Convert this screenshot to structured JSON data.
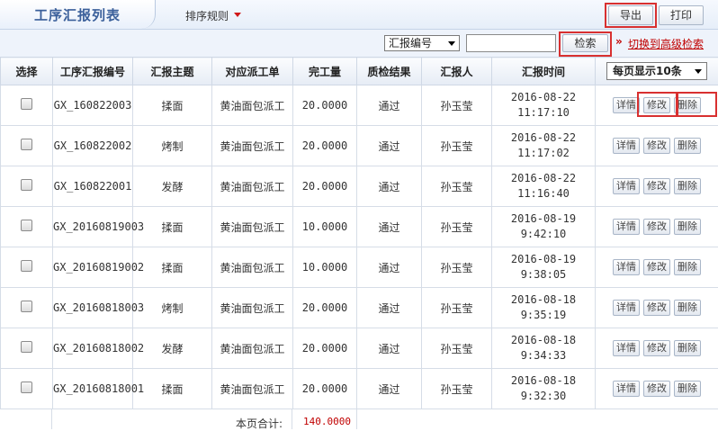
{
  "header": {
    "title": "工序汇报列表",
    "sort_label": "排序规则",
    "export_label": "导出",
    "print_label": "打印"
  },
  "search": {
    "field_selected": "汇报编号",
    "value": "",
    "search_label": "检索",
    "advanced_label": "切换到高级检索",
    "advanced_prefix": "»"
  },
  "table": {
    "columns": [
      "选择",
      "工序汇报编号",
      "汇报主题",
      "对应派工单",
      "完工量",
      "质检结果",
      "汇报人",
      "汇报时间"
    ],
    "per_page": "每页显示10条",
    "actions": {
      "detail": "详情",
      "edit": "修改",
      "delete": "删除"
    },
    "rows": [
      {
        "code": "GX_160822003",
        "subject": "揉面",
        "order": "黄油面包派工",
        "qty": "20.0000",
        "qc": "通过",
        "reporter": "孙玉莹",
        "time": "2016-08-22 11:17:10"
      },
      {
        "code": "GX_160822002",
        "subject": "烤制",
        "order": "黄油面包派工",
        "qty": "20.0000",
        "qc": "通过",
        "reporter": "孙玉莹",
        "time": "2016-08-22 11:17:02"
      },
      {
        "code": "GX_160822001",
        "subject": "发酵",
        "order": "黄油面包派工",
        "qty": "20.0000",
        "qc": "通过",
        "reporter": "孙玉莹",
        "time": "2016-08-22 11:16:40"
      },
      {
        "code": "GX_20160819003",
        "subject": "揉面",
        "order": "黄油面包派工",
        "qty": "10.0000",
        "qc": "通过",
        "reporter": "孙玉莹",
        "time": "2016-08-19 9:42:10"
      },
      {
        "code": "GX_20160819002",
        "subject": "揉面",
        "order": "黄油面包派工",
        "qty": "10.0000",
        "qc": "通过",
        "reporter": "孙玉莹",
        "time": "2016-08-19 9:38:05"
      },
      {
        "code": "GX_20160818003",
        "subject": "烤制",
        "order": "黄油面包派工",
        "qty": "20.0000",
        "qc": "通过",
        "reporter": "孙玉莹",
        "time": "2016-08-18 9:35:19"
      },
      {
        "code": "GX_20160818002",
        "subject": "发酵",
        "order": "黄油面包派工",
        "qty": "20.0000",
        "qc": "通过",
        "reporter": "孙玉莹",
        "time": "2016-08-18 9:34:33"
      },
      {
        "code": "GX_20160818001",
        "subject": "揉面",
        "order": "黄油面包派工",
        "qty": "20.0000",
        "qc": "通过",
        "reporter": "孙玉莹",
        "time": "2016-08-18 9:32:30"
      }
    ]
  },
  "footer": {
    "page_total_label": "本页合计:",
    "page_total_value": "140.0000"
  },
  "colors": {
    "title": "#3a5f9a",
    "link": "#3a6cb5",
    "accent_red": "#d83030"
  },
  "icons": {
    "title_icon": "arrow-right-icon",
    "sort_icon": "caret-down-icon"
  }
}
